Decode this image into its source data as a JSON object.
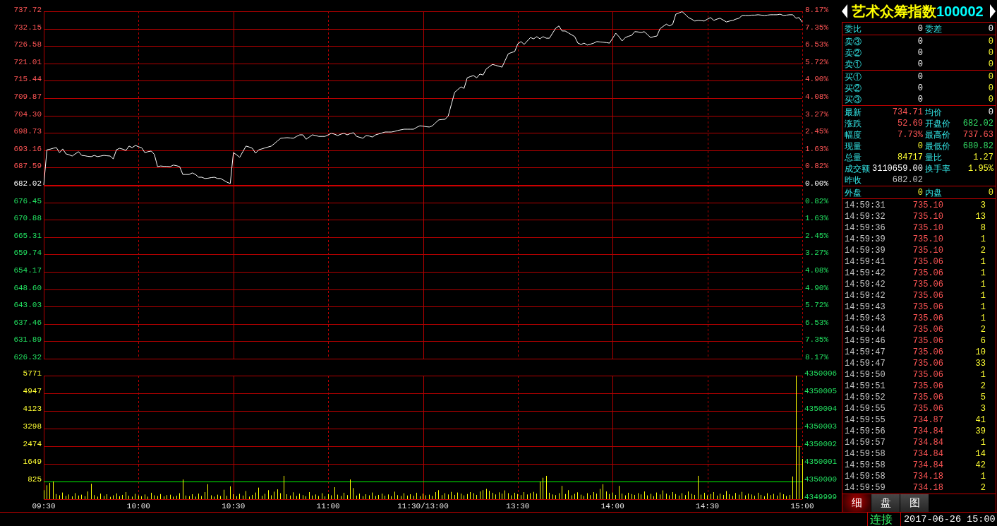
{
  "price_chart": {
    "pct_labels": [
      "8.17%",
      "7.35%",
      "6.53%",
      "5.72%",
      "4.90%",
      "4.08%",
      "3.27%",
      "2.45%",
      "1.63%",
      "0.82%",
      "0.00%",
      "0.82%",
      "1.63%",
      "2.45%",
      "3.27%",
      "4.08%",
      "4.90%",
      "5.72%",
      "6.53%",
      "7.35%",
      "8.17%"
    ],
    "chart_data": {
      "type": "line",
      "grid": true,
      "ylim": [
        626.32,
        737.72
      ],
      "yticks": [
        {
          "value": 737.72,
          "label": "737.72"
        },
        {
          "value": 732.15,
          "label": "732.15"
        },
        {
          "value": 726.58,
          "label": "726.58"
        },
        {
          "value": 721.01,
          "label": "721.01"
        },
        {
          "value": 715.44,
          "label": "715.44"
        },
        {
          "value": 709.87,
          "label": "709.87"
        },
        {
          "value": 704.3,
          "label": "704.30"
        },
        {
          "value": 698.73,
          "label": "698.73"
        },
        {
          "value": 693.16,
          "label": "693.16"
        },
        {
          "value": 687.59,
          "label": "687.59"
        },
        {
          "value": 682.02,
          "label": "682.02"
        },
        {
          "value": 676.45,
          "label": "676.45"
        },
        {
          "value": 670.88,
          "label": "670.88"
        },
        {
          "value": 665.31,
          "label": "665.31"
        },
        {
          "value": 659.74,
          "label": "659.74"
        },
        {
          "value": 654.17,
          "label": "654.17"
        },
        {
          "value": 648.6,
          "label": "648.60"
        },
        {
          "value": 643.03,
          "label": "643.03"
        },
        {
          "value": 637.46,
          "label": "637.46"
        },
        {
          "value": 631.89,
          "label": "631.89"
        },
        {
          "value": 626.32,
          "label": "626.32"
        }
      ],
      "ref_lines": [
        {
          "axis": "y",
          "value": 682.02,
          "color": "#cc0000"
        }
      ],
      "categories": [
        null,
        null,
        null,
        null,
        null,
        null,
        null,
        null,
        null,
        null,
        null,
        null,
        null,
        null,
        null,
        null,
        null,
        null,
        null,
        null,
        null,
        null,
        null,
        null,
        null,
        null,
        null,
        null,
        null,
        null,
        null,
        null,
        null,
        null,
        null,
        null,
        null,
        null,
        null,
        null,
        null,
        null,
        null,
        null,
        null,
        null,
        null,
        null,
        null,
        null,
        null,
        null,
        null,
        null,
        null,
        null,
        null,
        null,
        null,
        null,
        null,
        null,
        null,
        null,
        null,
        null,
        null,
        null,
        null,
        null,
        null,
        null,
        null,
        null,
        null,
        null,
        null,
        null,
        null,
        null,
        null,
        null,
        null,
        null,
        null,
        null,
        null,
        null,
        null,
        null,
        null,
        null,
        null,
        null,
        null,
        null,
        null,
        null,
        null,
        null,
        null,
        null,
        null,
        null,
        null,
        null,
        null,
        null,
        null,
        null,
        null,
        null,
        null,
        null,
        null,
        null,
        null,
        null,
        null,
        null,
        null,
        null,
        null,
        null,
        null,
        null,
        null,
        null,
        null,
        null,
        null,
        null,
        null,
        null,
        null,
        null,
        null,
        null,
        null,
        null,
        null,
        null,
        null,
        null,
        null,
        null,
        null,
        null,
        null,
        null,
        null,
        null,
        null,
        null,
        null,
        null,
        null,
        null,
        null,
        null,
        null,
        null,
        null,
        null,
        null,
        null,
        null,
        null,
        null,
        null,
        null,
        null,
        null,
        null,
        null,
        null,
        null,
        null,
        null,
        null,
        null,
        null,
        null,
        null,
        null,
        null,
        null,
        null,
        null,
        null,
        null,
        null,
        null,
        null,
        null,
        null,
        null,
        null,
        null,
        null,
        null,
        null,
        null,
        null,
        null,
        null,
        null,
        null,
        null,
        null,
        null,
        null,
        null,
        null,
        null,
        null,
        null,
        null,
        null,
        null,
        null,
        null,
        null,
        null,
        null,
        null,
        null,
        null,
        null,
        null,
        null,
        null,
        null,
        null,
        null,
        null,
        null,
        null,
        null,
        null,
        null
      ],
      "series": [
        {
          "color": "#ffffff",
          "values": [
            682.0,
            693.3,
            693.5,
            693.8,
            694.0,
            692.4,
            693.6,
            692.0,
            691.7,
            691.3,
            692.0,
            692.7,
            691.5,
            691.4,
            691.2,
            691.1,
            691.5,
            691.1,
            691.3,
            691.5,
            691.4,
            691.3,
            690.4,
            693.3,
            693.8,
            693.5,
            693.1,
            694.5,
            694.0,
            694.7,
            694.3,
            693.9,
            692.4,
            692.7,
            692.9,
            691.8,
            687.9,
            688.1,
            688.0,
            688.0,
            687.9,
            688.4,
            688.2,
            687.9,
            685.4,
            685.4,
            685.4,
            685.9,
            685.4,
            684.5,
            684.5,
            684.1,
            684.2,
            684.4,
            684.5,
            684.1,
            684.1,
            683.5,
            682.9,
            682.5,
            692.4,
            691.7,
            690.9,
            692.7,
            694.5,
            694.2,
            693.8,
            692.2,
            693.3,
            693.6,
            693.9,
            694.2,
            694.5,
            695.3,
            696.2,
            697.0,
            697.1,
            697.2,
            697.1,
            697.0,
            697.6,
            698.1,
            698.1,
            696.7,
            697.4,
            698.1,
            697.9,
            697.6,
            697.6,
            697.6,
            698.1,
            698.6,
            698.3,
            697.9,
            698.3,
            698.6,
            698.1,
            698.5,
            698.8,
            697.6,
            697.3,
            697.0,
            697.9,
            697.7,
            697.4,
            698.1,
            698.4,
            698.7,
            699.0,
            699.0,
            699.0,
            699.2,
            699.5,
            699.7,
            699.9,
            699.9,
            699.9,
            699.9,
            700.5,
            701.0,
            700.9,
            700.7,
            700.6,
            701.0,
            702.0,
            702.9,
            703.0,
            703.1,
            704.2,
            708.0,
            711.7,
            712.6,
            713.5,
            713.0,
            716.4,
            716.8,
            717.1,
            716.4,
            717.6,
            717.3,
            719.2,
            720.0,
            720.7,
            720.4,
            720.1,
            719.8,
            722.0,
            724.1,
            724.5,
            724.8,
            727.3,
            728.0,
            727.1,
            728.2,
            729.3,
            728.9,
            729.6,
            728.9,
            729.6,
            729.1,
            729.1,
            730.7,
            732.3,
            733.0,
            731.4,
            731.4,
            730.8,
            730.2,
            729.6,
            727.5,
            727.1,
            727.5,
            726.9,
            727.2,
            727.5,
            728.0,
            727.9,
            727.8,
            727.7,
            727.5,
            729.1,
            730.7,
            729.6,
            728.2,
            729.3,
            729.7,
            730.0,
            731.2,
            731.1,
            730.9,
            731.2,
            730.3,
            729.3,
            729.6,
            729.8,
            732.1,
            732.9,
            733.6,
            733.0,
            733.6,
            736.8,
            737.2,
            737.6,
            736.7,
            735.7,
            735.2,
            734.6,
            734.8,
            734.7,
            734.6,
            735.2,
            735.7,
            734.8,
            735.2,
            735.5,
            734.9,
            734.3,
            734.6,
            734.8,
            735.2,
            735.5,
            736.4,
            736.4,
            736.4,
            736.5,
            736.5,
            736.6,
            736.5,
            736.4,
            736.5,
            736.6,
            736.6,
            736.6,
            736.8,
            736.4,
            736.5,
            736.6,
            736.6,
            735.5,
            735.7,
            734.2
          ]
        }
      ]
    }
  },
  "volume_chart": {
    "right_labels": [
      "4350006",
      "4350005",
      "4350004",
      "4350003",
      "4350002",
      "4350001",
      "4350000",
      "4349999"
    ],
    "chart_data": {
      "type": "bar",
      "grid": true,
      "ylim": [
        0,
        5771
      ],
      "categories": [
        "09:30",
        null,
        null,
        null,
        null,
        null,
        null,
        null,
        null,
        null,
        null,
        null,
        null,
        null,
        null,
        null,
        null,
        null,
        null,
        null,
        null,
        null,
        null,
        null,
        null,
        null,
        null,
        null,
        null,
        null,
        "10:00",
        null,
        null,
        null,
        null,
        null,
        null,
        null,
        null,
        null,
        null,
        null,
        null,
        null,
        null,
        null,
        null,
        null,
        null,
        null,
        null,
        null,
        null,
        null,
        null,
        null,
        null,
        null,
        null,
        null,
        "10:30",
        null,
        null,
        null,
        null,
        null,
        null,
        null,
        null,
        null,
        null,
        null,
        null,
        null,
        null,
        null,
        null,
        null,
        null,
        null,
        null,
        null,
        null,
        null,
        null,
        null,
        null,
        null,
        null,
        null,
        "11:00",
        null,
        null,
        null,
        null,
        null,
        null,
        null,
        null,
        null,
        null,
        null,
        null,
        null,
        null,
        null,
        null,
        null,
        null,
        null,
        null,
        null,
        null,
        null,
        null,
        null,
        null,
        null,
        null,
        null,
        "11:30/13:00",
        null,
        null,
        null,
        null,
        null,
        null,
        null,
        null,
        null,
        null,
        null,
        null,
        null,
        null,
        null,
        null,
        null,
        null,
        null,
        null,
        null,
        null,
        null,
        null,
        null,
        null,
        null,
        null,
        null,
        "13:30",
        null,
        null,
        null,
        null,
        null,
        null,
        null,
        null,
        null,
        null,
        null,
        null,
        null,
        null,
        null,
        null,
        null,
        null,
        null,
        null,
        null,
        null,
        null,
        null,
        null,
        null,
        null,
        null,
        null,
        "14:00",
        null,
        null,
        null,
        null,
        null,
        null,
        null,
        null,
        null,
        null,
        null,
        null,
        null,
        null,
        null,
        null,
        null,
        null,
        null,
        null,
        null,
        null,
        null,
        null,
        null,
        null,
        null,
        null,
        null,
        "14:30",
        null,
        null,
        null,
        null,
        null,
        null,
        null,
        null,
        null,
        null,
        null,
        null,
        null,
        null,
        null,
        null,
        null,
        null,
        null,
        null,
        null,
        null,
        null,
        null,
        null,
        null,
        null,
        null,
        null,
        "15:00"
      ],
      "yticks": [
        {
          "value": 5771,
          "label": "5771"
        },
        {
          "value": 4947,
          "label": "4947"
        },
        {
          "value": 4123,
          "label": "4123"
        },
        {
          "value": 3298,
          "label": "3298"
        },
        {
          "value": 2474,
          "label": "2474"
        },
        {
          "value": 1649,
          "label": "1649"
        },
        {
          "value": 825,
          "label": "825"
        }
      ],
      "ref_lines": [
        {
          "axis": "y",
          "value": 825,
          "color": "#00ff00"
        }
      ],
      "series": [
        {
          "color": "#ffff00",
          "values": [
            420,
            650,
            760,
            830,
            240,
            180,
            310,
            150,
            220,
            130,
            280,
            170,
            210,
            140,
            360,
            720,
            190,
            120,
            260,
            150,
            230,
            110,
            180,
            270,
            140,
            200,
            330,
            160,
            120,
            250,
            170,
            140,
            220,
            120,
            300,
            180,
            150,
            240,
            130,
            190,
            210,
            120,
            160,
            280,
            920,
            170,
            140,
            230,
            120,
            260,
            150,
            330,
            700,
            180,
            120,
            210,
            150,
            440,
            160,
            600,
            230,
            140,
            250,
            170,
            380,
            120,
            200,
            310,
            540,
            160,
            250,
            420,
            180,
            350,
            460,
            280,
            1090,
            230,
            170,
            320,
            150,
            260,
            190,
            140,
            330,
            170,
            220,
            150,
            280,
            130,
            240,
            180,
            560,
            210,
            150,
            300,
            190,
            920,
            520,
            170,
            260,
            140,
            230,
            180,
            310,
            150,
            200,
            260,
            160,
            220,
            140,
            350,
            190,
            150,
            280,
            170,
            230,
            160,
            300,
            140,
            260,
            180,
            210,
            150,
            330,
            420,
            190,
            280,
            220,
            340,
            200,
            310,
            260,
            180,
            240,
            330,
            280,
            200,
            360,
            420,
            480,
            390,
            300,
            220,
            320,
            260,
            410,
            280,
            180,
            300,
            240,
            190,
            330,
            220,
            280,
            340,
            260,
            830,
            1000,
            1090,
            300,
            220,
            190,
            280,
            620,
            240,
            420,
            180,
            250,
            320,
            210,
            150,
            280,
            190,
            330,
            260,
            480,
            700,
            360,
            240,
            310,
            200,
            620,
            260,
            180,
            300,
            240,
            200,
            280,
            220,
            360,
            180,
            250,
            140,
            310,
            220,
            410,
            260,
            180,
            330,
            240,
            170,
            280,
            190,
            360,
            250,
            200,
            1090,
            210,
            300,
            180,
            240,
            330,
            170,
            260,
            200,
            380,
            230,
            150,
            290,
            210,
            340,
            180,
            260,
            220,
            160,
            300,
            200,
            140,
            280,
            190,
            250,
            170,
            310,
            230,
            150,
            200,
            1060,
            5770,
            2470,
            1880
          ]
        }
      ]
    }
  },
  "quote_panel": {
    "title": {
      "name": "艺术众筹指数",
      "code": "100002"
    },
    "sections": [
      {
        "kind": "pairs",
        "rows": [
          [
            {
              "label": "委比",
              "value": "0",
              "color": "#ffffff"
            },
            {
              "label": "委差",
              "value": "0",
              "color": "#ffffff"
            }
          ]
        ]
      },
      {
        "kind": "book",
        "rows": [
          {
            "label": "卖③",
            "price": "0",
            "volume": "0"
          },
          {
            "label": "卖②",
            "price": "0",
            "volume": "0"
          },
          {
            "label": "卖①",
            "price": "0",
            "volume": "0"
          }
        ]
      },
      {
        "kind": "book",
        "rows": [
          {
            "label": "买①",
            "price": "0",
            "volume": "0"
          },
          {
            "label": "买②",
            "price": "0",
            "volume": "0"
          },
          {
            "label": "买③",
            "price": "0",
            "volume": "0"
          }
        ]
      },
      {
        "kind": "pairs",
        "rows": [
          [
            {
              "label": "最新",
              "value": "734.71",
              "color": "#ff5555"
            },
            {
              "label": "均价",
              "value": "0",
              "color": "#ffffff"
            }
          ],
          [
            {
              "label": "涨跌",
              "value": "52.69",
              "color": "#ff5555"
            },
            {
              "label": "开盘价",
              "value": "682.02",
              "color": "#33dd66"
            }
          ],
          [
            {
              "label": "幅度",
              "value": "7.73%",
              "color": "#ff5555"
            },
            {
              "label": "最高价",
              "value": "737.63",
              "color": "#ff5555"
            }
          ],
          [
            {
              "label": "现量",
              "value": "0",
              "color": "#ffff33"
            },
            {
              "label": "最低价",
              "value": "680.82",
              "color": "#33dd66"
            }
          ],
          [
            {
              "label": "总量",
              "value": "84717",
              "color": "#ffff33"
            },
            {
              "label": "量比",
              "value": "1.27",
              "color": "#ffff33"
            }
          ],
          [
            {
              "label": "成交额",
              "value": "3110659.00",
              "color": "#ffffff"
            },
            {
              "label": "换手率",
              "value": "1.95%",
              "color": "#ffff33"
            }
          ],
          [
            {
              "label": "昨收",
              "value": "682.02",
              "color": "#c8c8c8"
            }
          ]
        ]
      },
      {
        "kind": "pairs",
        "rows": [
          [
            {
              "label": "外盘",
              "value": "0",
              "color": "#ffff33"
            },
            {
              "label": "内盘",
              "value": "0",
              "color": "#ffff33"
            }
          ]
        ]
      },
      {
        "kind": "trades",
        "rows": [
          {
            "time": "14:59:31",
            "price": "735.10",
            "volume": "3"
          },
          {
            "time": "14:59:32",
            "price": "735.10",
            "volume": "13"
          },
          {
            "time": "14:59:36",
            "price": "735.10",
            "volume": "8"
          },
          {
            "time": "14:59:39",
            "price": "735.10",
            "volume": "1"
          },
          {
            "time": "14:59:39",
            "price": "735.10",
            "volume": "2"
          },
          {
            "time": "14:59:41",
            "price": "735.06",
            "volume": "1"
          },
          {
            "time": "14:59:42",
            "price": "735.06",
            "volume": "1"
          },
          {
            "time": "14:59:42",
            "price": "735.06",
            "volume": "1"
          },
          {
            "time": "14:59:42",
            "price": "735.06",
            "volume": "1"
          },
          {
            "time": "14:59:43",
            "price": "735.06",
            "volume": "1"
          },
          {
            "time": "14:59:43",
            "price": "735.06",
            "volume": "1"
          },
          {
            "time": "14:59:44",
            "price": "735.06",
            "volume": "2"
          },
          {
            "time": "14:59:46",
            "price": "735.06",
            "volume": "6"
          },
          {
            "time": "14:59:47",
            "price": "735.06",
            "volume": "10"
          },
          {
            "time": "14:59:47",
            "price": "735.06",
            "volume": "33"
          },
          {
            "time": "14:59:50",
            "price": "735.06",
            "volume": "1"
          },
          {
            "time": "14:59:51",
            "price": "735.06",
            "volume": "2"
          },
          {
            "time": "14:59:52",
            "price": "735.06",
            "volume": "5"
          },
          {
            "time": "14:59:55",
            "price": "735.06",
            "volume": "3"
          },
          {
            "time": "14:59:55",
            "price": "734.87",
            "volume": "41"
          },
          {
            "time": "14:59:56",
            "price": "734.84",
            "volume": "39"
          },
          {
            "time": "14:59:57",
            "price": "734.84",
            "volume": "1"
          },
          {
            "time": "14:59:58",
            "price": "734.84",
            "volume": "14"
          },
          {
            "time": "14:59:58",
            "price": "734.84",
            "volume": "42"
          },
          {
            "time": "14:59:58",
            "price": "734.18",
            "volume": "1"
          },
          {
            "time": "14:59:59",
            "price": "734.18",
            "volume": "2"
          }
        ]
      }
    ],
    "tabs": [
      {
        "label": "细",
        "selected": true
      },
      {
        "label": "盘",
        "selected": false
      },
      {
        "label": "图",
        "selected": false
      }
    ]
  },
  "status_bar": {
    "connection": "连接",
    "datetime": "2017-06-26 15:00"
  }
}
